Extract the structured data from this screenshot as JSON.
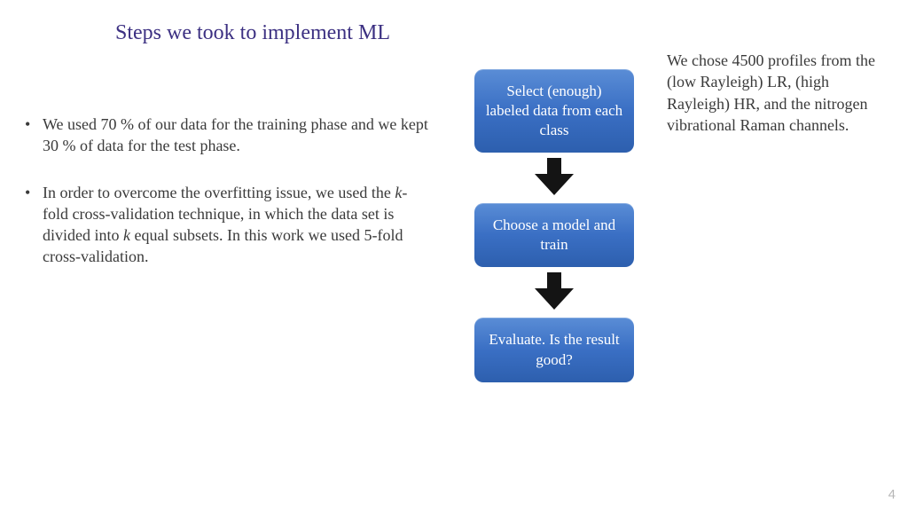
{
  "title": "Steps we took to implement ML",
  "bullets": {
    "b1": "We used 70 % of our data for the training phase and we kept 30 % of data for the test phase.",
    "b2_pre": "In order to overcome the overfitting issue, we used the ",
    "b2_k1": "k",
    "b2_mid1": "-fold cross-validation technique, in which the data set is divided into ",
    "b2_k2": "k",
    "b2_mid2": " equal subsets. In this work we used 5-fold cross-validation."
  },
  "flow": {
    "box1": "Select (enough) labeled data from each class",
    "box2": "Choose a model and train",
    "box3": "Evaluate. Is the result good?"
  },
  "right_text": "We chose 4500 profiles from the (low Rayleigh) LR, (high Rayleigh) HR, and the nitrogen vibrational Raman channels.",
  "page_number": "4"
}
